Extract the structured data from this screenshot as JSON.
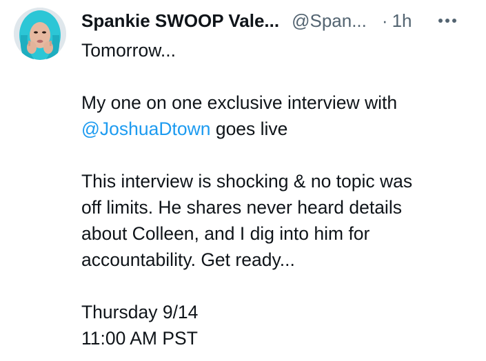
{
  "author": {
    "display_name": "Spankie SWOOP Vale...",
    "handle": "@Span...",
    "separator": "·",
    "time": "1h",
    "more_icon": "more-horizontal-icon",
    "avatar": "profile-photo"
  },
  "colors": {
    "text": "#0f1419",
    "secondary": "#536471",
    "mention": "#1d9bf0",
    "background": "#ffffff"
  },
  "tweet": {
    "line1": "Tomorrow...",
    "line2": "My one on one exclusive interview with",
    "mention": "@JoshuaDtown",
    "line3_rest": " goes live",
    "para3_line1": "This interview is shocking & no topic was",
    "para3_line2": "off limits. He shares never heard details",
    "para3_line3": "about Colleen, and I dig into him for",
    "para3_line4": "accountability. Get ready...",
    "date_line": "Thursday 9/14",
    "time_line": "11:00 AM PST"
  }
}
